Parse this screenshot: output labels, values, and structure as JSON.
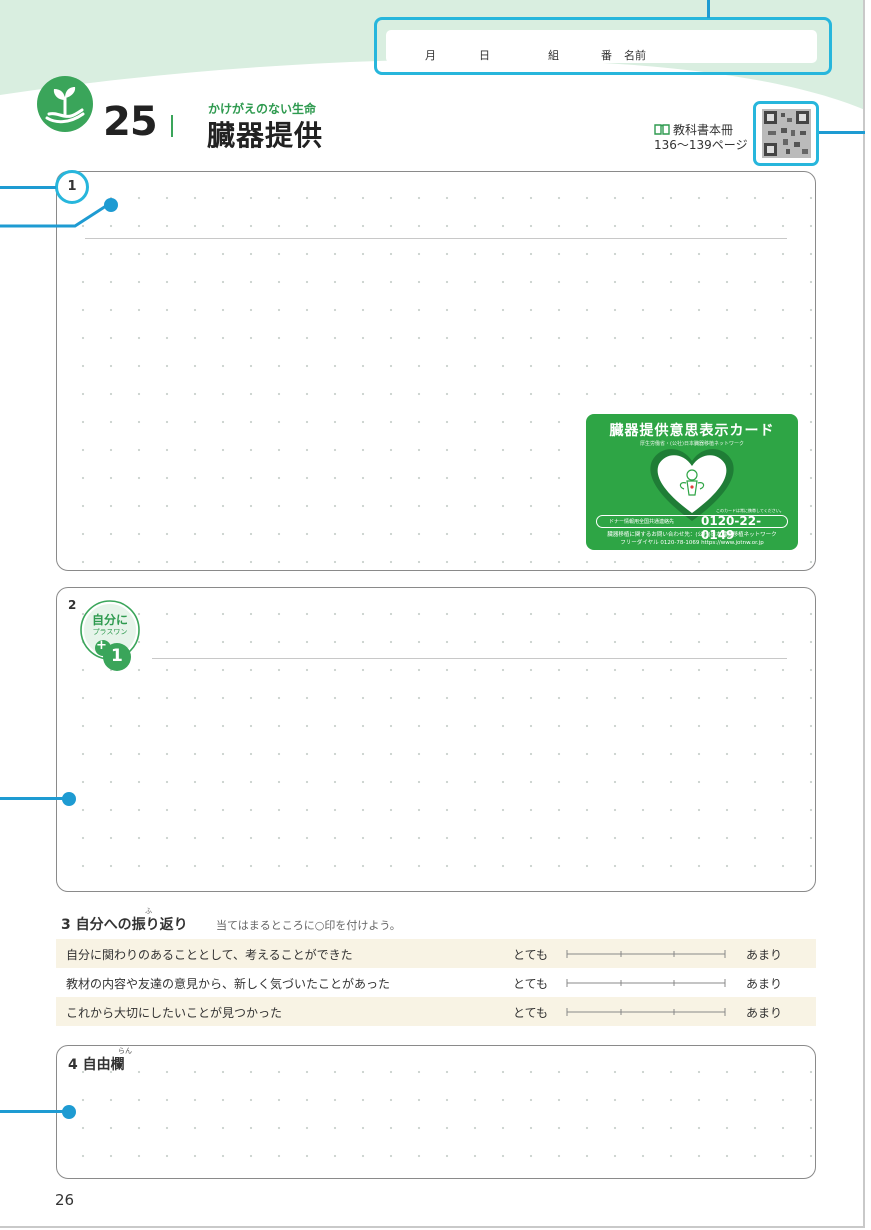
{
  "header": {
    "name_fields": [
      "月",
      "日",
      "組",
      "番",
      "名前"
    ]
  },
  "lesson": {
    "number": "25",
    "theme": "かけがえのない生命",
    "title": "臓器提供",
    "textbook_ref_line1": "教科書本冊",
    "textbook_ref_line2": "136〜139ページ"
  },
  "question1": {
    "number": "1"
  },
  "donor_card": {
    "title": "臓器提供意思表示カード",
    "subtitle": "厚生労働省・(公社)日本臓器移植ネットワーク",
    "note": "このカードは常に携帯してください。",
    "phone_label": "ドナー情報用全国共通連絡先",
    "phone": "0120-22-0149",
    "footer_line1": "臓器移植に関するお問い合わせ先：(公社)日本臓器移植ネットワーク",
    "footer_line2": "フリーダイヤル 0120-78-1069 https://www.jotnw.or.jp"
  },
  "question2": {
    "number": "2",
    "badge_line1": "自分に",
    "badge_line2": "プラスワン",
    "badge_plus": "+",
    "badge_one": "1"
  },
  "section3": {
    "heading": "3  自分への振り返り",
    "ruby": "ふ",
    "instruction": "当てはまるところに○印を付けよう。",
    "scale_left": "とても",
    "scale_right": "あまり",
    "items": [
      "自分に関わりのあることとして、考えることができた",
      "教材の内容や友達の意見から、新しく気づいたことがあった",
      "これから大切にしたいことが見つかった"
    ]
  },
  "section4": {
    "title": "4  自由欄",
    "ruby": "らん"
  },
  "footer": {
    "page_number": "26"
  },
  "colors": {
    "accent_green": "#3aa55a",
    "header_green": "#d9eee0",
    "annotation_blue": "#1e9bd2",
    "row_shade": "#f8f3e4"
  }
}
